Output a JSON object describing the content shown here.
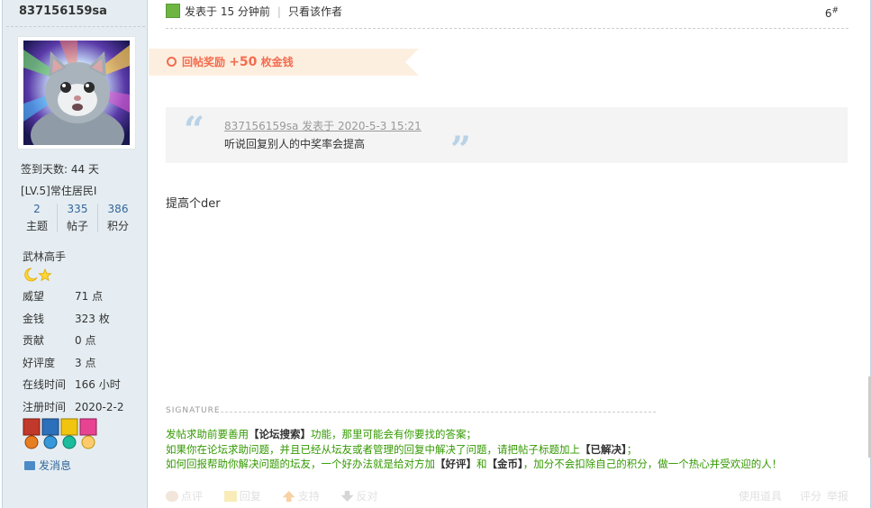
{
  "user": {
    "name": "837156159sa",
    "sign_days": "签到天数: 44 天",
    "level": "[LV.5]常住居民I",
    "stats": [
      {
        "num": "2",
        "label": "主题"
      },
      {
        "num": "335",
        "label": "帖子"
      },
      {
        "num": "386",
        "label": "积分"
      }
    ],
    "title": "武林高手",
    "props": [
      {
        "key": "威望",
        "value": "71 点"
      },
      {
        "key": "金钱",
        "value": "323 枚"
      },
      {
        "key": "贡献",
        "value": "0 点"
      },
      {
        "key": "好评度",
        "value": "3 点"
      },
      {
        "key": "在线时间",
        "value": "166 小时"
      },
      {
        "key": "注册时间",
        "value": "2020-2-2"
      }
    ],
    "send_message": "发消息"
  },
  "post": {
    "posted": "发表于 15 分钟前",
    "only_author": "只看该作者",
    "floor": "6",
    "floor_sup": "#",
    "reward_prefix": "回帖奖励",
    "reward_amount": "+50",
    "reward_suffix": "枚金钱",
    "quote_author": "837156159sa 发表于 2020-5-3 15:21",
    "quote_text": "听说回复别人的中奖率会提高",
    "content": "提高个der",
    "signature_label": "SIGNATURE",
    "sig_lines": [
      [
        "发帖求助前要善用",
        "【论坛搜索】",
        "功能，那里可能会有你要找的答案；"
      ],
      [
        "如果你在论坛求助问题，并且已经从坛友或者管理的回复中解决了问题，请把帖子标题加上",
        "【已解决】",
        "；"
      ],
      [
        "如何回报帮助你解决问题的坛友，一个好办法就是给对方加",
        "【好评】",
        "和",
        "【金币】",
        "，加分不会扣除自己的积分，做一个热心并受欢迎的人！"
      ]
    ],
    "actions": [
      "点评",
      "回复",
      "支持",
      "反对"
    ],
    "actions_right": [
      "使用道具",
      "评分",
      "举报"
    ]
  },
  "colors": {
    "accent": "#369",
    "reward": "#f26c4f",
    "signature": "#339900",
    "sidebar_bg": "#e5edf2"
  }
}
